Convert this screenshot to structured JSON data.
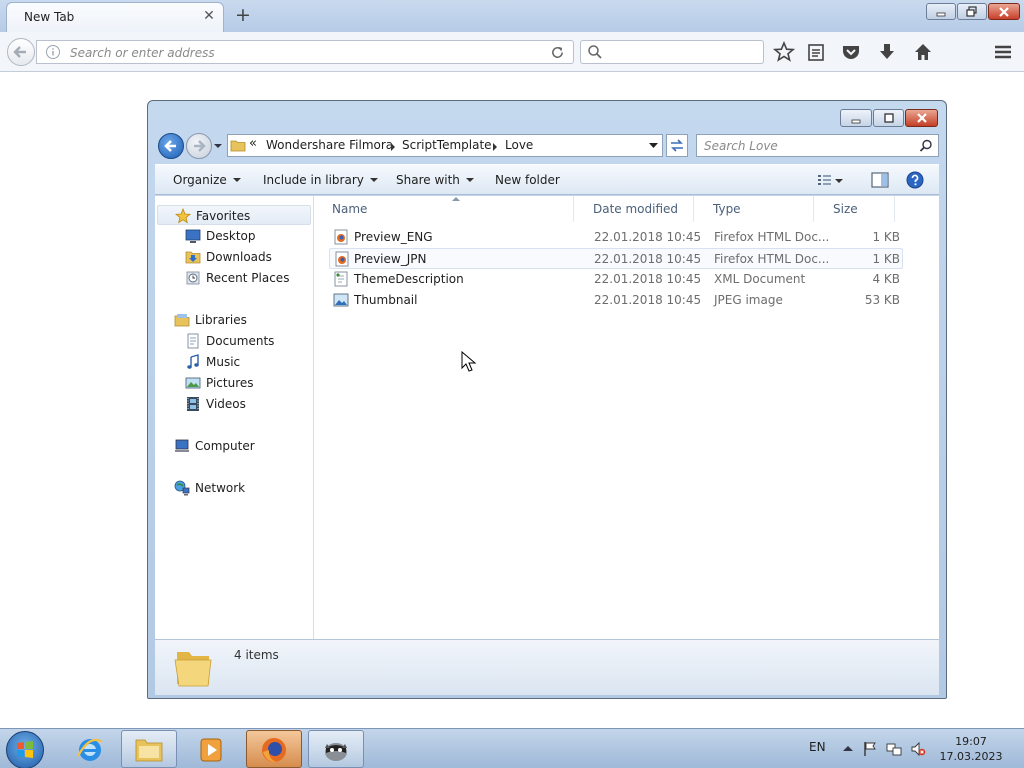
{
  "browser": {
    "tab_title": "New Tab",
    "url_placeholder": "Search or enter address",
    "search_placeholder": ""
  },
  "explorer": {
    "breadcrumb": [
      "Wondershare Filmora",
      "ScriptTemplate",
      "Love"
    ],
    "search_placeholder": "Search Love",
    "toolbar": {
      "organize": "Organize",
      "include_in_library": "Include in library",
      "share_with": "Share with",
      "new_folder": "New folder"
    },
    "sidebar": {
      "favorites": "Favorites",
      "desktop": "Desktop",
      "downloads": "Downloads",
      "recent_places": "Recent Places",
      "libraries": "Libraries",
      "documents": "Documents",
      "music": "Music",
      "pictures": "Pictures",
      "videos": "Videos",
      "computer": "Computer",
      "network": "Network"
    },
    "columns": {
      "name": "Name",
      "date_modified": "Date modified",
      "type": "Type",
      "size": "Size"
    },
    "files": [
      {
        "name": "Preview_ENG",
        "date": "22.01.2018 10:45",
        "type": "Firefox HTML Doc...",
        "size": "1 KB",
        "icon": "firefox-html-icon"
      },
      {
        "name": "Preview_JPN",
        "date": "22.01.2018 10:45",
        "type": "Firefox HTML Doc...",
        "size": "1 KB",
        "icon": "firefox-html-icon"
      },
      {
        "name": "ThemeDescription",
        "date": "22.01.2018 10:45",
        "type": "XML Document",
        "size": "4 KB",
        "icon": "xml-document-icon"
      },
      {
        "name": "Thumbnail",
        "date": "22.01.2018 10:45",
        "type": "JPEG image",
        "size": "53 KB",
        "icon": "jpeg-image-icon"
      }
    ],
    "item_count": "4 items"
  },
  "taskbar": {
    "language": "EN",
    "time": "19:07",
    "date": "17.03.2023"
  },
  "colors": {
    "explorer_frame": "#b2c9e4",
    "taskbar": "#9fb9d8",
    "active_task": "#d68d4e",
    "close_button": "#c33f27"
  }
}
